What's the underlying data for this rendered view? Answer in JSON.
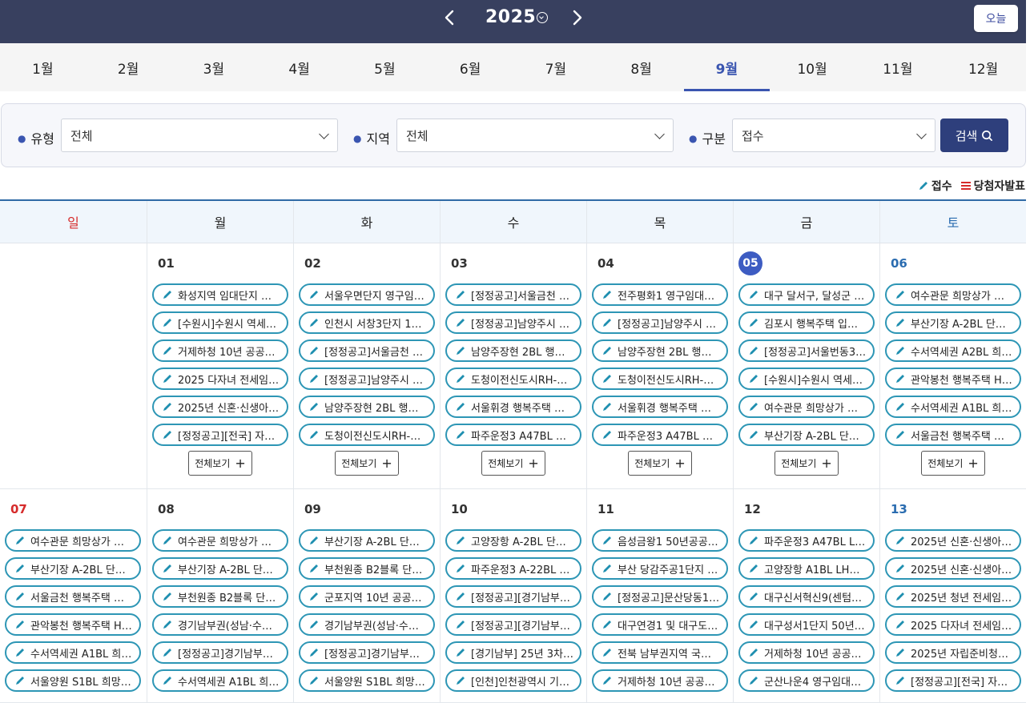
{
  "header": {
    "year": "2025",
    "today_label": "오늘",
    "prev_icon": "chevron-left-icon",
    "next_icon": "chevron-right-icon"
  },
  "months": [
    "1월",
    "2월",
    "3월",
    "4월",
    "5월",
    "6월",
    "7월",
    "8월",
    "9월",
    "10월",
    "11월",
    "12월"
  ],
  "active_month": "9월",
  "filter": {
    "type_label": "유형",
    "type_value": "전체",
    "region_label": "지역",
    "region_value": "전체",
    "category_label": "구분",
    "category_value": "접수",
    "search_label": "검색"
  },
  "legend": {
    "receive": "접수",
    "winner": "당첨자발표"
  },
  "weekdays": [
    "일",
    "월",
    "화",
    "수",
    "목",
    "금",
    "토"
  ],
  "more_label": "전체보기",
  "week1": [
    {
      "num": "",
      "events": []
    },
    {
      "num": "01",
      "events": [
        "화성지역 임대단지 관리...",
        "[수원시]수원시 역세권 ...",
        "거제하청 10년 공공임...",
        "2025 다자녀 전세임대 ...",
        "2025년 신혼·신생아 전...",
        "[정정공고][전국] 자립..."
      ]
    },
    {
      "num": "02",
      "events": [
        "서울우면단지 영구임대...",
        "인천시 서창3단지 10년...",
        "[정정공고]서울금천 행...",
        "[정정공고]남양주시 행...",
        "남양주장현 2BL 행복주...",
        "도청이전신도시RH-10..."
      ]
    },
    {
      "num": "03",
      "events": [
        "[정정공고]서울금천 행...",
        "[정정공고]남양주시 행...",
        "남양주장현 2BL 행복주...",
        "도청이전신도시RH-10...",
        "서울휘경 행복주택 예비...",
        "파주운정3 A47BL 행..."
      ]
    },
    {
      "num": "04",
      "events": [
        "전주평화1 영구임대상...",
        "[정정공고]남양주시 행...",
        "남양주장현 2BL 행복주...",
        "도청이전신도시RH-10...",
        "서울휘경 행복주택 예비...",
        "파주운정3 A47BL 행..."
      ]
    },
    {
      "num": "05",
      "events": [
        "대구 달서구, 달성군 비...",
        "김포시 행복주택 입주자...",
        "[정정공고]서울번동3 ...",
        "[수원시]수원시 역세권 ...",
        "여수관문 희망상가 입점...",
        "부산기장 A-2BL 단지..."
      ]
    },
    {
      "num": "06",
      "events": [
        "여수관문 희망상가 입점...",
        "부산기장 A-2BL 단지...",
        "수서역세권 A2BL 희망...",
        "관악봉천 행복주택 H-1,...",
        "수서역세권 A1BL 희망...",
        "서울금천 행복주택 희망..."
      ]
    }
  ],
  "week2": [
    {
      "num": "07",
      "events": [
        "여수관문 희망상가 입점...",
        "부산기장 A-2BL 단지...",
        "서울금천 행복주택 희망...",
        "관악봉천 행복주택 H-1,...",
        "수서역세권 A1BL 희망...",
        "서울양원 S1BL 희망상..."
      ]
    },
    {
      "num": "08",
      "events": [
        "여수관문 희망상가 입점...",
        "부산기장 A-2BL 단지...",
        "부천원종 B2블록 단지 ...",
        "경기남부권(성남·수원·...",
        "[정정공고]경기남부권(...",
        "수서역세권 A1BL 희망..."
      ]
    },
    {
      "num": "09",
      "events": [
        "부산기장 A-2BL 단지...",
        "부천원종 B2블록 단지 ...",
        "군포지역 10년 공공임...",
        "경기남부권(성남·수원·...",
        "[정정공고]경기남부권(...",
        "서울양원 S1BL 희망상..."
      ]
    },
    {
      "num": "10",
      "events": [
        "고양장항 A-2BL 단지...",
        "파주운정3 A-22BL 단...",
        "[정정공고][경기남부] 2...",
        "[정정공고][경기남부] 2...",
        "[경기남부] 25년 3차 ...",
        "[인천]인천광역시 기존..."
      ]
    },
    {
      "num": "11",
      "events": [
        "음성금왕1 50년공공임...",
        "부산 당감주공1단지 50...",
        "[정정공고]문산당동1단...",
        "대구연경1 및 대구도남 ...",
        "전북 남부권지역 국민임...",
        "거제하청 10년 공공임..."
      ]
    },
    {
      "num": "12",
      "events": [
        "파주운정3 A47BL LH...",
        "고양장항 A1BL LH희망...",
        "대구신서혁신9(센텀힐...",
        "대구성서1단지 50년공...",
        "거제하청 10년 공공임...",
        "군산나운4 영구임대주..."
      ]
    },
    {
      "num": "13",
      "events": [
        "2025년 신혼·신생아 전...",
        "2025년 신혼·신생아 전...",
        "2025년 청년 전세임대 ...",
        "2025 다자녀 전세임대 ...",
        "2025년 자립준비청년(...",
        "[정정공고][전국] 자립..."
      ]
    }
  ],
  "colors": {
    "header_bg": "#38405f",
    "accent": "#3a55b0",
    "event_border": "#2d96b5",
    "sunday": "#d62b2b",
    "saturday": "#2a6cb0"
  }
}
